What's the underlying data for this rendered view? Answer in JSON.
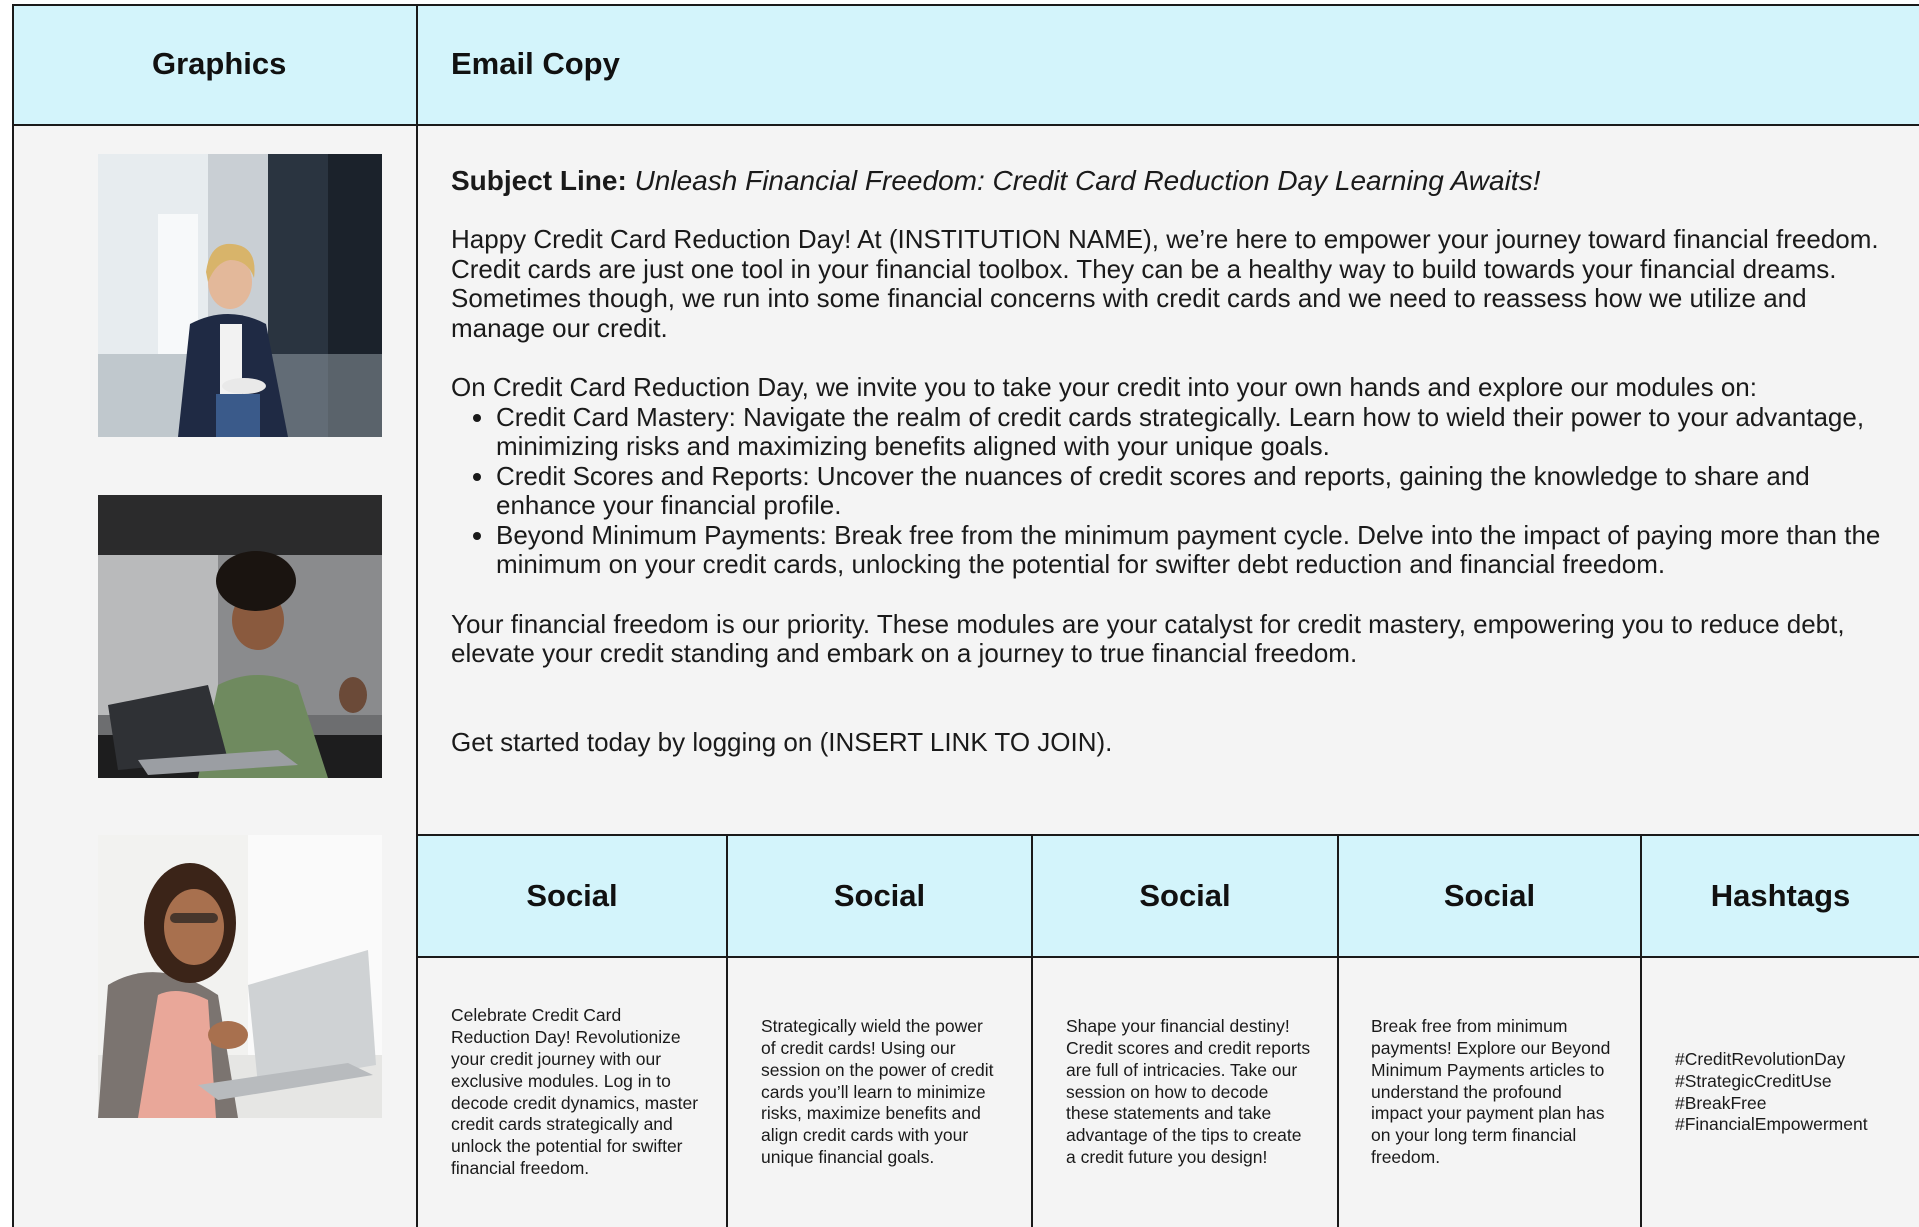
{
  "headers": {
    "graphics": "Graphics",
    "email_copy": "Email Copy"
  },
  "images": [
    {
      "name": "woman-presenting-photo"
    },
    {
      "name": "woman-laptop-classroom-photo"
    },
    {
      "name": "woman-laptop-smiling-photo"
    }
  ],
  "email": {
    "subject_label": "Subject Line:",
    "subject_text": "Unleash Financial Freedom: Credit Card Reduction Day Learning Awaits!",
    "intro": "Happy Credit Card Reduction Day! At (INSTITUTION NAME), we’re here to empower your journey toward financial freedom.  Credit cards are just one tool in your financial toolbox.  They can be a healthy way to build towards your financial dreams.  Sometimes though, we run into some financial concerns with credit cards and we need to reassess how we utilize and manage our credit.",
    "modules_intro": "On Credit Card Reduction Day, we invite you to take your credit into your own hands and explore our modules on:",
    "modules": [
      "Credit Card Mastery:  Navigate the realm of credit cards strategically. Learn how to wield their power to your advantage, minimizing risks and maximizing benefits aligned with your unique goals.",
      "Credit Scores and Reports: Uncover the nuances of credit scores and reports, gaining the knowledge to share and enhance your financial profile.",
      "Beyond Minimum Payments: Break free from the minimum payment cycle.  Delve into the impact of paying more than the minimum on your credit cards, unlocking the potential for swifter debt reduction and financial freedom."
    ],
    "priority": "Your financial freedom is our priority.  These modules are your catalyst for credit mastery, empowering you to reduce debt, elevate your credit standing and embark on a journey to true financial freedom.",
    "cta": "Get started today by logging on (INSERT LINK TO JOIN)."
  },
  "social": {
    "headers": [
      "Social",
      "Social",
      "Social",
      "Social",
      "Hashtags"
    ],
    "posts": [
      "Celebrate Credit Card Reduction Day! Revolutionize your credit journey with our exclusive modules. Log in to decode credit dynamics, master credit cards strategically and unlock the potential for swifter financial freedom.",
      "Strategically wield the power of credit cards! Using our session on the power of credit cards you’ll learn to minimize risks, maximize benefits and align credit cards with your unique financial goals.",
      "Shape your financial destiny! Credit scores and credit reports are full of intricacies. Take our session on how to decode these statements and take advantage of the tips to create a credit future you design!",
      "Break free from minimum payments! Explore our Beyond Minimum Payments articles to understand the profound impact your payment plan has on your long term financial freedom."
    ],
    "hashtags": [
      "#CreditRevolutionDay",
      "#StrategicCreditUse",
      "#BreakFree",
      "#FinancialEmpowerment"
    ]
  }
}
